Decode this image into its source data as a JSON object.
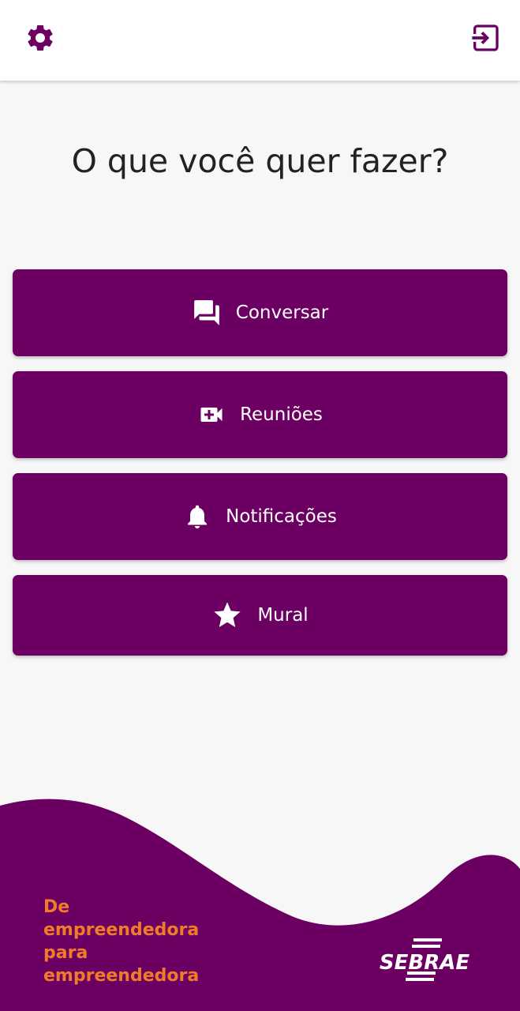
{
  "header": {
    "settings_icon": "gear-icon",
    "logout_icon": "logout-icon"
  },
  "main": {
    "title": "O que você quer fazer?"
  },
  "menu": [
    {
      "label": "Conversar",
      "icon": "chat-icon"
    },
    {
      "label": "Reuniões",
      "icon": "video-plus-icon"
    },
    {
      "label": "Notificações",
      "icon": "bell-icon"
    },
    {
      "label": "Mural",
      "icon": "star-icon"
    }
  ],
  "footer": {
    "tagline": [
      "De",
      "empreendedora",
      "para",
      "empreendedora"
    ],
    "logo_text": "SEBRAE"
  },
  "colors": {
    "primary": "#6b0062",
    "accent": "#f07c2a",
    "background": "#f7f7f8"
  }
}
